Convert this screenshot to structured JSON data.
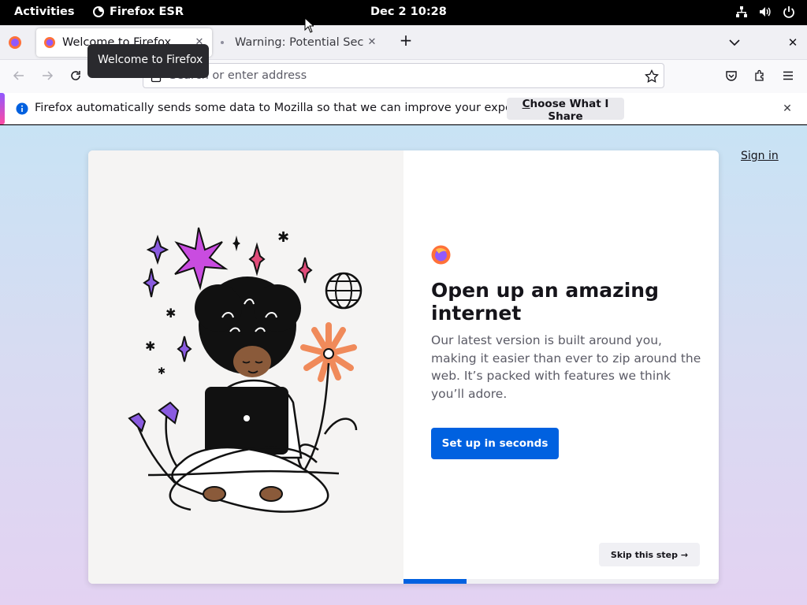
{
  "system_bar": {
    "activities": "Activities",
    "app_name": "Firefox ESR",
    "clock": "Dec 2  10:28"
  },
  "tabs": [
    {
      "label": "Welcome to Firefox",
      "active": true
    },
    {
      "label": "Warning: Potential Security Risk Ahead",
      "active": false
    }
  ],
  "tooltip": "Welcome to Firefox",
  "urlbar": {
    "placeholder": "Search or enter address",
    "value": ""
  },
  "notification": {
    "message": "Firefox automatically sends some data to Mozilla so that we can improve your experience.",
    "button_first_letter": "C",
    "button_rest": "hoose What I Share"
  },
  "page": {
    "signin": "Sign in",
    "title": "Open up an amazing internet",
    "body": "Our latest version is built around you, making it easier than ever to zip around the web. It’s packed with features we think you’ll adore.",
    "primary_button": "Set up in seconds",
    "skip_button": "Skip this step",
    "progress": 0.2
  },
  "colors": {
    "accent": "#0061e0",
    "topbar": "#000000"
  },
  "icons": [
    "firefox-logo-icon",
    "network-icon",
    "volume-icon",
    "power-icon",
    "back-icon",
    "forward-icon",
    "reload-icon",
    "page-icon",
    "bookmark-star-icon",
    "pocket-icon",
    "extensions-icon",
    "menu-icon",
    "info-icon",
    "close-icon"
  ]
}
